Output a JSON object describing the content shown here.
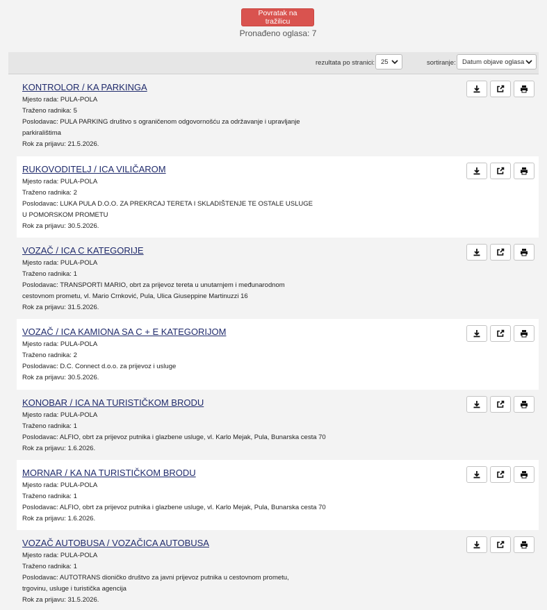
{
  "header": {
    "back_button": "Povratak na tražilicu",
    "found_text": "Pronađeno oglasa: 7"
  },
  "toolbar": {
    "per_page_label": "rezultata po stranici:",
    "per_page_value": "25",
    "sort_label": "sortiranje:",
    "sort_value": "Datum objave oglasa"
  },
  "jobs": [
    {
      "title": "KONTROLOR / KA PARKINGA",
      "location": "Mjesto rada: PULA-POLA",
      "workers": "Traženo radnika: 5",
      "employer": "Poslodavac: PULA PARKING društvo s ograničenom odgovornošću za održavanje i upravljanje parkiralištima",
      "deadline": "Rok za prijavu: 21.5.2026."
    },
    {
      "title": "RUKOVODITELJ / ICA VILIČAROM",
      "location": "Mjesto rada: PULA-POLA",
      "workers": "Traženo radnika: 2",
      "employer": "Poslodavac: LUKA PULA D.O.O. ZA PREKRCAJ TERETA I SKLADIŠTENJE TE OSTALE USLUGE U POMORSKOM PROMETU",
      "deadline": "Rok za prijavu: 30.5.2026."
    },
    {
      "title": "VOZAČ / ICA C KATEGORIJE",
      "location": "Mjesto rada: PULA-POLA",
      "workers": "Traženo radnika: 1",
      "employer": "Poslodavac: TRANSPORTI MARIO, obrt za prijevoz tereta u unutarnjem i međunarodnom cestovnom prometu, vl. Mario Crnković, Pula, Ulica Giuseppine Martinuzzi 16",
      "deadline": "Rok za prijavu: 31.5.2026."
    },
    {
      "title": "VOZAČ / ICA KAMIONA SA C + E KATEGORIJOM",
      "location": "Mjesto rada: PULA-POLA",
      "workers": "Traženo radnika: 2",
      "employer": "Poslodavac: D.C. Connect d.o.o. za prijevoz i usluge",
      "deadline": "Rok za prijavu: 30.5.2026."
    },
    {
      "title": "KONOBAR / ICA NA TURISTIČKOM BRODU",
      "location": "Mjesto rada: PULA-POLA",
      "workers": "Traženo radnika: 1",
      "employer": "Poslodavac: ALFIO, obrt za prijevoz putnika i glazbene usluge, vl. Karlo Mejak, Pula, Bunarska cesta 70",
      "deadline": "Rok za prijavu: 1.6.2026."
    },
    {
      "title": "MORNAR / KA NA TURISTIČKOM BRODU",
      "location": "Mjesto rada: PULA-POLA",
      "workers": "Traženo radnika: 1",
      "employer": "Poslodavac: ALFIO, obrt za prijevoz putnika i glazbene usluge, vl. Karlo Mejak, Pula, Bunarska cesta 70",
      "deadline": "Rok za prijavu: 1.6.2026."
    },
    {
      "title": "VOZAČ AUTOBUSA / VOZAČICA AUTOBUSA",
      "location": "Mjesto rada: PULA-POLA",
      "workers": "Traženo radnika: 1",
      "employer": "Poslodavac: AUTOTRANS dioničko društvo za javni prijevoz putnika u cestovnom prometu, trgovinu, usluge i turistička agencija",
      "deadline": "Rok za prijavu: 31.5.2026."
    }
  ],
  "colors": {
    "back_button_bg": "#d9534f",
    "title_link": "#1f2a6b",
    "row_alt": "#f3f3f3",
    "row_white": "#ffffff"
  },
  "icons": [
    "download-icon",
    "external-link-icon",
    "print-icon",
    "chevron-down-icon"
  ]
}
